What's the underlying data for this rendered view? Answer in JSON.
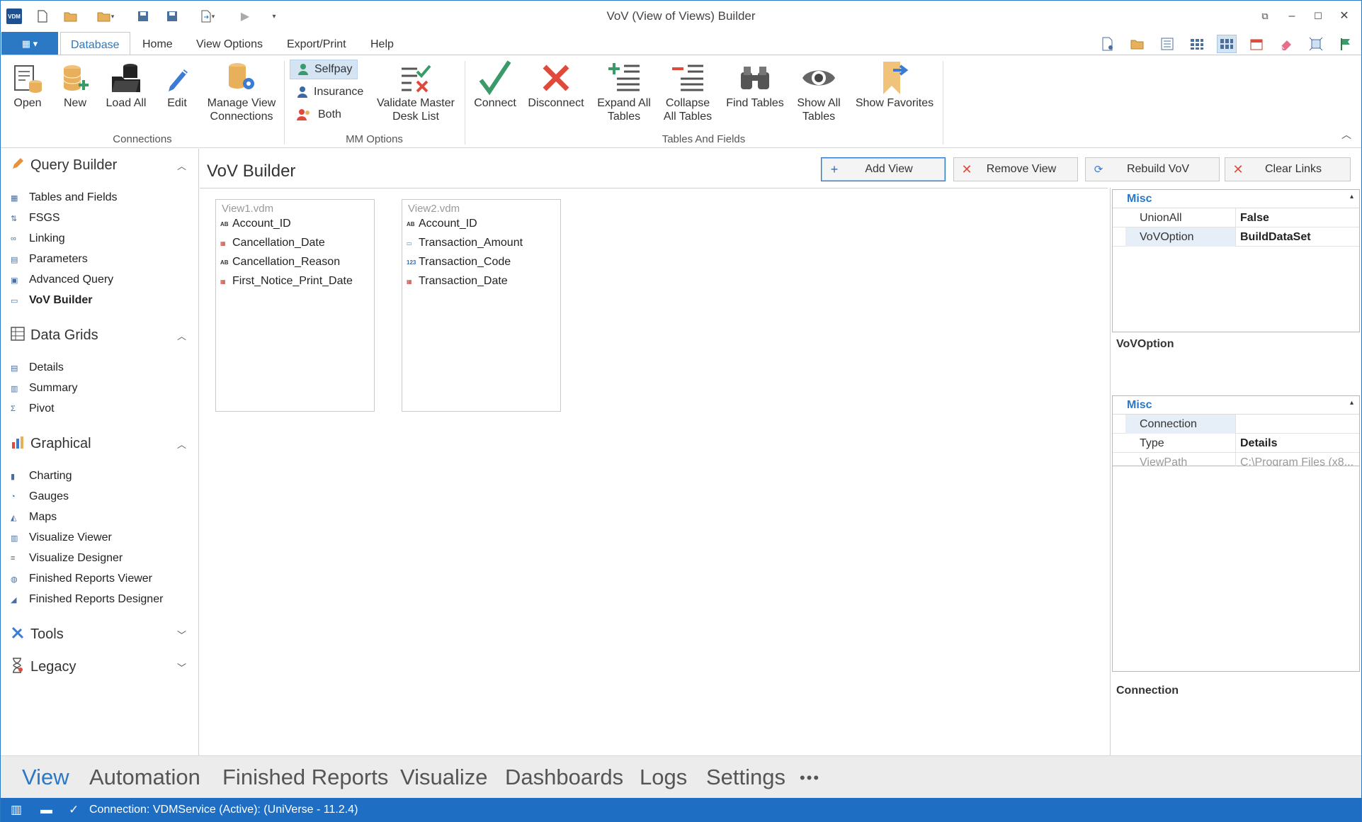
{
  "window": {
    "title": "VoV (View of Views) Builder",
    "logo_text": "VDM",
    "controls": [
      "⧉",
      "–",
      "☐",
      "✕"
    ]
  },
  "ribbon_tabs": {
    "file_label": "▦ ▾",
    "tabs": [
      "Database",
      "Home",
      "View Options",
      "Export/Print",
      "Help"
    ]
  },
  "ribbon": {
    "connections": {
      "label": "Connections",
      "open": "Open",
      "new": "New",
      "load_all": "Load All",
      "edit": "Edit",
      "manage_line1": "Manage View",
      "manage_line2": "Connections"
    },
    "mm_options": {
      "label": "MM Options",
      "selfpay": "Selfpay",
      "insurance": "Insurance",
      "both": "Both",
      "validate_line1": "Validate Master",
      "validate_line2": "Desk List"
    },
    "tables_and_fields": {
      "label": "Tables And Fields",
      "connect": "Connect",
      "disconnect": "Disconnect",
      "expand_line1": "Expand All",
      "expand_line2": "Tables",
      "collapse_line1": "Collapse",
      "collapse_line2": "All Tables",
      "find_tables": "Find Tables",
      "show_line1": "Show All",
      "show_line2": "Tables",
      "show_favorites": "Show Favorites"
    }
  },
  "leftnav": {
    "query_builder": {
      "title": "Query Builder",
      "items": [
        "Tables and Fields",
        "FSGS",
        "Linking",
        "Parameters",
        "Advanced Query",
        "VoV Builder"
      ]
    },
    "data_grids": {
      "title": "Data Grids",
      "items": [
        "Details",
        "Summary",
        "Pivot"
      ]
    },
    "graphical": {
      "title": "Graphical",
      "items": [
        "Charting",
        "Gauges",
        "Maps",
        "Visualize Viewer",
        "Visualize Designer",
        "Finished Reports Viewer",
        "Finished Reports Designer"
      ]
    },
    "tools": {
      "title": "Tools"
    },
    "legacy": {
      "title": "Legacy"
    }
  },
  "content": {
    "title": "VoV Builder",
    "buttons": {
      "add_view": "Add View",
      "remove_view": "Remove View",
      "rebuild_vov": "Rebuild VoV",
      "clear_links": "Clear Links"
    },
    "views": [
      {
        "name": "View1.vdm",
        "fields": [
          {
            "type": "AB",
            "name": "Account_ID"
          },
          {
            "type": "date",
            "name": "Cancellation_Date"
          },
          {
            "type": "AB",
            "name": "Cancellation_Reason"
          },
          {
            "type": "date",
            "name": "First_Notice_Print_Date"
          }
        ]
      },
      {
        "name": "View2.vdm",
        "fields": [
          {
            "type": "AB",
            "name": "Account_ID"
          },
          {
            "type": "money",
            "name": "Transaction_Amount"
          },
          {
            "type": "123",
            "name": "Transaction_Code"
          },
          {
            "type": "date",
            "name": "Transaction_Date"
          }
        ]
      }
    ]
  },
  "properties": {
    "grid1": {
      "category": "Misc",
      "rows": [
        {
          "name": "UnionAll",
          "value": "False"
        },
        {
          "name": "VoVOption",
          "value": "BuildDataSet"
        }
      ],
      "description": "VoVOption"
    },
    "grid2": {
      "category": "Misc",
      "rows": [
        {
          "name": "Connection",
          "value": ""
        },
        {
          "name": "Type",
          "value": "Details"
        },
        {
          "name": "ViewPath",
          "value": "C:\\Program Files (x8..."
        }
      ],
      "description": "Connection"
    }
  },
  "bottomnav": {
    "items": [
      "View",
      "Automation",
      "Finished Reports",
      "Visualize",
      "Dashboards",
      "Logs",
      "Settings",
      "•••"
    ],
    "active": "View"
  },
  "statusbar": {
    "text": "Connection: VDMService (Active): (UniVerse - 11.2.4)"
  },
  "colors": {
    "accent": "#2b78c5",
    "status_bar": "#1e6ec3",
    "red": "#e04a3a",
    "green": "#3a9a6a",
    "gold": "#e8b05a"
  }
}
